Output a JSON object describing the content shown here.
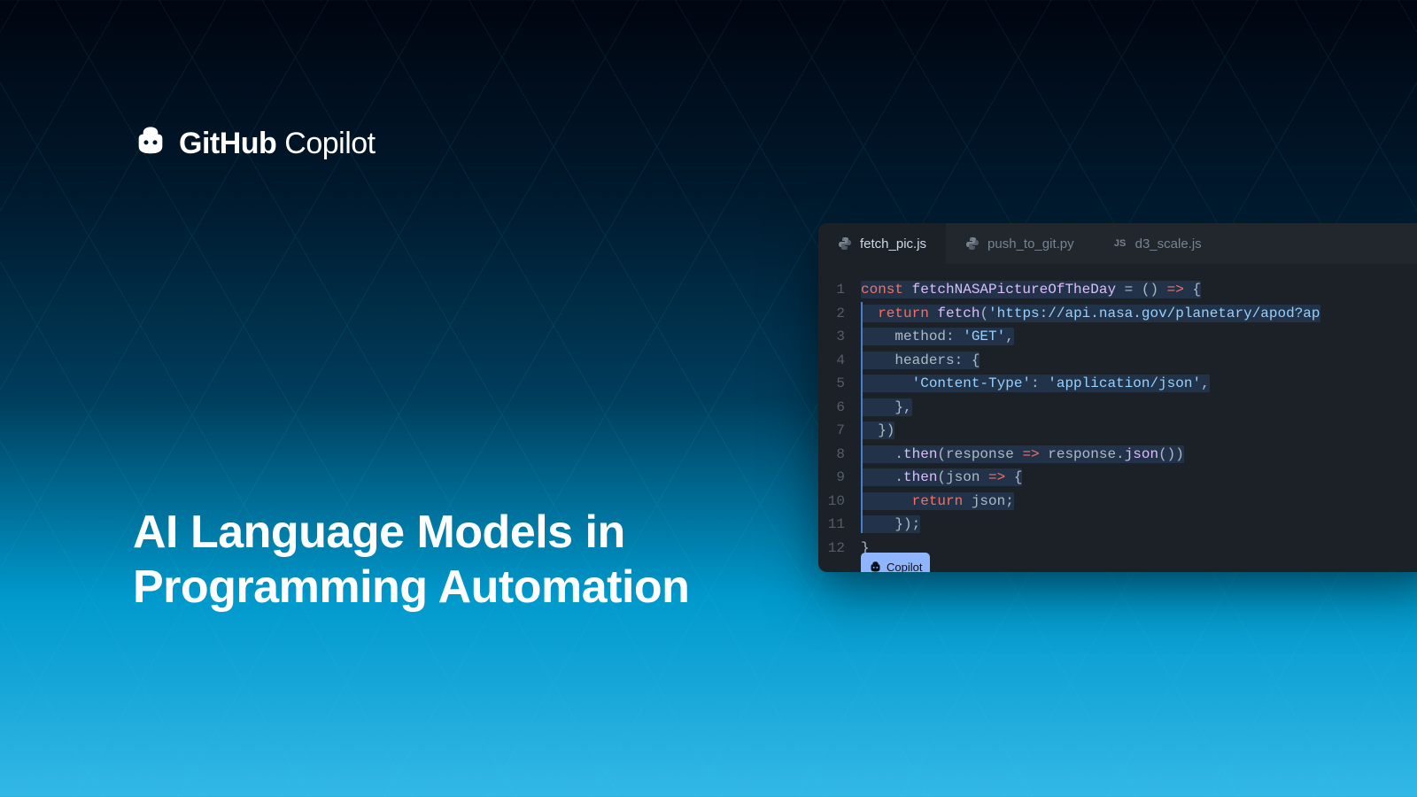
{
  "logo": {
    "brand": "GitHub",
    "product": "Copilot"
  },
  "headline": {
    "line1": "AI Language Models in",
    "line2": "Programming Automation"
  },
  "editor": {
    "tabs": [
      {
        "name": "fetch_pic.js",
        "icon": "python-icon",
        "active": true
      },
      {
        "name": "push_to_git.py",
        "icon": "python-icon",
        "active": false
      },
      {
        "name": "d3_scale.js",
        "icon": "js-icon",
        "active": false
      }
    ],
    "badge": "Copilot",
    "code": [
      {
        "n": "1",
        "tokens": [
          [
            "kw",
            "const "
          ],
          [
            "fn",
            "fetchNASAPictureOfTheDay"
          ],
          [
            "",
            " = () "
          ],
          [
            "kw",
            "=>"
          ],
          [
            "",
            " {"
          ]
        ],
        "hl": true
      },
      {
        "n": "2",
        "tokens": [
          [
            "",
            "  "
          ],
          [
            "kw",
            "return"
          ],
          [
            "",
            " "
          ],
          [
            "fn",
            "fetch"
          ],
          [
            "",
            "("
          ],
          [
            "str",
            "'https://api.nasa.gov/planetary/apod?ap"
          ]
        ],
        "hl": true
      },
      {
        "n": "3",
        "tokens": [
          [
            "",
            "    method: "
          ],
          [
            "str",
            "'GET'"
          ],
          [
            "",
            ","
          ]
        ],
        "hl": true
      },
      {
        "n": "4",
        "tokens": [
          [
            "",
            "    headers: {"
          ]
        ],
        "hl": true
      },
      {
        "n": "5",
        "tokens": [
          [
            "",
            "      "
          ],
          [
            "str",
            "'Content-Type'"
          ],
          [
            "",
            ": "
          ],
          [
            "str",
            "'application/json'"
          ],
          [
            "",
            ","
          ]
        ],
        "hl": true
      },
      {
        "n": "6",
        "tokens": [
          [
            "",
            "    },"
          ]
        ],
        "hl": true
      },
      {
        "n": "7",
        "tokens": [
          [
            "",
            "  })"
          ]
        ],
        "hl": true
      },
      {
        "n": "8",
        "tokens": [
          [
            "",
            "    ."
          ],
          [
            "fn",
            "then"
          ],
          [
            "",
            "(response "
          ],
          [
            "kw",
            "=>"
          ],
          [
            "",
            " response."
          ],
          [
            "fn",
            "json"
          ],
          [
            "",
            "())"
          ]
        ],
        "hl": true
      },
      {
        "n": "9",
        "tokens": [
          [
            "",
            "    ."
          ],
          [
            "fn",
            "then"
          ],
          [
            "",
            "(json "
          ],
          [
            "kw",
            "=>"
          ],
          [
            "",
            " {"
          ]
        ],
        "hl": true
      },
      {
        "n": "10",
        "tokens": [
          [
            "",
            "      "
          ],
          [
            "kw",
            "return"
          ],
          [
            "",
            " json;"
          ]
        ],
        "hl": true
      },
      {
        "n": "11",
        "tokens": [
          [
            "",
            "    });"
          ]
        ],
        "hl": true
      },
      {
        "n": "12",
        "tokens": [
          [
            "",
            "}"
          ]
        ],
        "hl": false
      }
    ]
  }
}
